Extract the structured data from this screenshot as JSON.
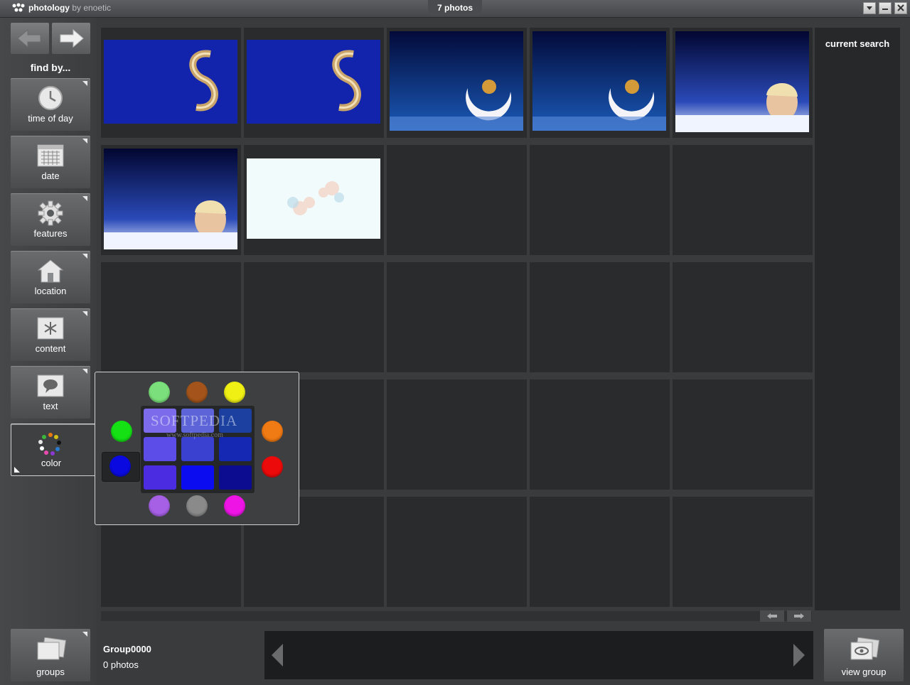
{
  "titlebar": {
    "app_name": "photology",
    "by_text": "by enoetic",
    "photo_count": "7 photos",
    "controls": {
      "dropdown": "chevron-down-icon",
      "minimize": "minimize-icon",
      "close": "close-icon"
    }
  },
  "sidebar": {
    "nav": {
      "back": "arrow-left-icon",
      "forward": "arrow-right-icon"
    },
    "find_by": "find by...",
    "filters": [
      {
        "label": "time of day",
        "icon": "clock-icon"
      },
      {
        "label": "date",
        "icon": "calendar-icon"
      },
      {
        "label": "features",
        "icon": "gear-icon"
      },
      {
        "label": "location",
        "icon": "house-icon"
      },
      {
        "label": "content",
        "icon": "asterisk-icon"
      },
      {
        "label": "text",
        "icon": "speech-bubble-icon"
      },
      {
        "label": "color",
        "icon": "color-wheel-icon",
        "active": true
      }
    ],
    "groups_label": "groups"
  },
  "right_panel": {
    "title": "current search"
  },
  "photos": [
    {
      "style": "s-logo"
    },
    {
      "style": "s-logo"
    },
    {
      "style": "moon"
    },
    {
      "style": "moon"
    },
    {
      "style": "portrait"
    },
    {
      "style": "portrait"
    },
    {
      "style": "flowers"
    }
  ],
  "scroll": {
    "left": "arrow-left-icon",
    "right": "arrow-right-icon"
  },
  "group": {
    "name": "Group0000",
    "count": "0 photos",
    "view_label": "view group"
  },
  "color_picker": {
    "selected": "#0a0ae0",
    "dots": {
      "top": [
        "#7be07b",
        "#a4541a",
        "#f0f014"
      ],
      "left": [
        "#14e014"
      ],
      "right": [
        "#f07a14",
        "#ec0a0a"
      ],
      "bottom": [
        "#a660e6",
        "#8a8a8a",
        "#ee14e6"
      ]
    },
    "swatches": [
      [
        "#7c6cec",
        "#5c64d8",
        "#1c40a0"
      ],
      [
        "#5c4ce8",
        "#3a40d0",
        "#1428b4"
      ],
      [
        "#4c2ce0",
        "#0c0cf0",
        "#0c0c90"
      ]
    ],
    "watermark": "SOFTPEDIA",
    "watermark_url": "www.softpedia.com"
  }
}
